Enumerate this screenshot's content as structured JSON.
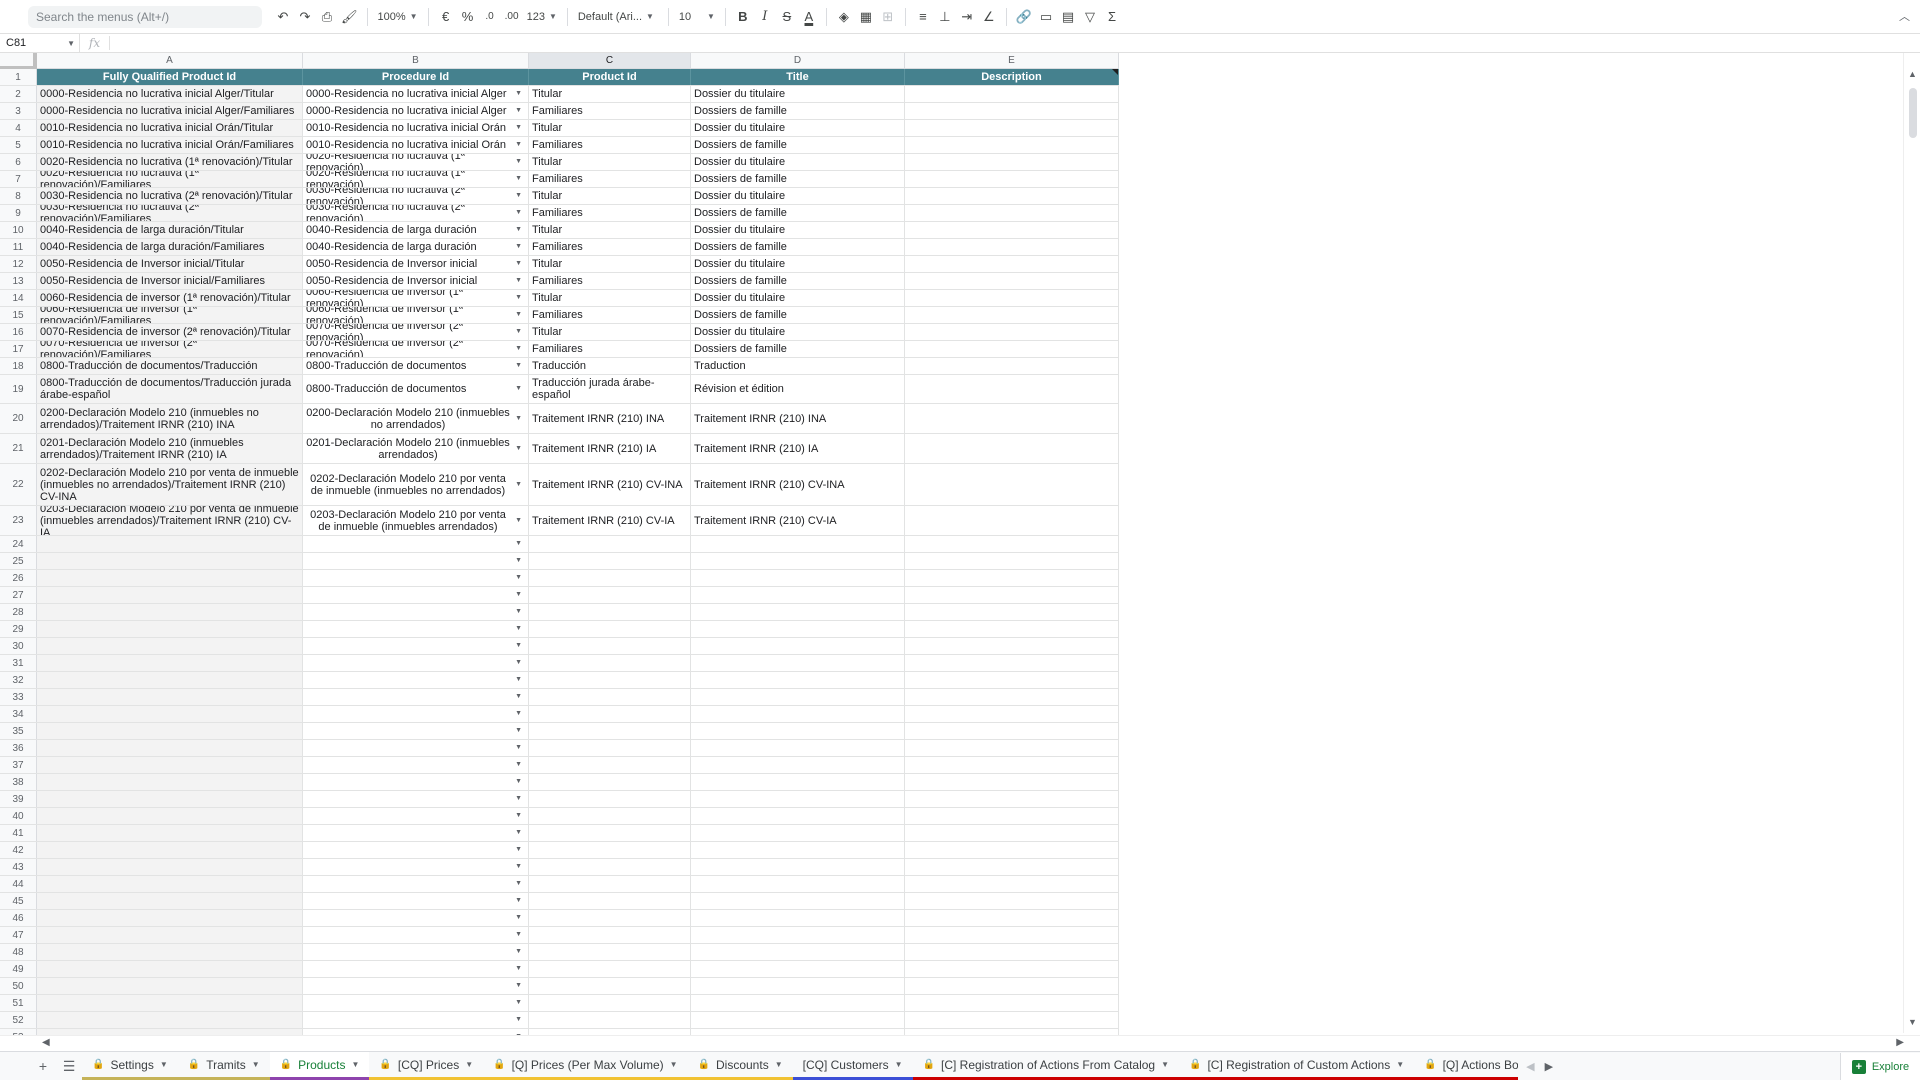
{
  "toolbar": {
    "search_placeholder": "Search the menus (Alt+/)",
    "zoom": "100%",
    "currency": "€",
    "percent": "%",
    "decrease_decimal": ".0",
    "increase_decimal": ".00",
    "number_format": "123",
    "font": "Default (Ari...",
    "font_size": "10",
    "bold": "B",
    "italic": "I",
    "strike": "S",
    "text_color": "A",
    "sum": "Σ"
  },
  "formula_bar": {
    "name_box": "C81",
    "fx": "fx"
  },
  "columns": [
    {
      "letter": "A",
      "width": 266,
      "selected": false
    },
    {
      "letter": "B",
      "width": 226,
      "selected": false
    },
    {
      "letter": "C",
      "width": 162,
      "selected": true
    },
    {
      "letter": "D",
      "width": 214,
      "selected": false
    },
    {
      "letter": "E",
      "width": 214,
      "selected": false
    }
  ],
  "header_row": [
    "Fully Qualified Product Id",
    "Procedure Id",
    "Product Id",
    "Title",
    "Description"
  ],
  "rows": [
    {
      "n": "2",
      "h": 17,
      "c": [
        "0000-Residencia no lucrativa inicial Alger/Titular",
        "0000-Residencia no lucrativa inicial Alger",
        "Titular",
        "Dossier du titulaire",
        ""
      ]
    },
    {
      "n": "3",
      "h": 17,
      "c": [
        "0000-Residencia no lucrativa inicial Alger/Familiares",
        "0000-Residencia no lucrativa inicial Alger",
        "Familiares",
        "Dossiers de famille",
        ""
      ]
    },
    {
      "n": "4",
      "h": 17,
      "c": [
        "0010-Residencia no lucrativa inicial Orán/Titular",
        "0010-Residencia no lucrativa inicial Orán",
        "Titular",
        "Dossier du titulaire",
        ""
      ]
    },
    {
      "n": "5",
      "h": 17,
      "c": [
        "0010-Residencia no lucrativa inicial Orán/Familiares",
        "0010-Residencia no lucrativa inicial Orán",
        "Familiares",
        "Dossiers de famille",
        ""
      ]
    },
    {
      "n": "6",
      "h": 17,
      "c": [
        "0020-Residencia no lucrativa (1ª renovación)/Titular",
        "0020-Residencia no lucrativa (1ª renovación)",
        "Titular",
        "Dossier du titulaire",
        ""
      ]
    },
    {
      "n": "7",
      "h": 17,
      "c": [
        "0020-Residencia no lucrativa (1ª renovación)/Familiares",
        "0020-Residencia no lucrativa (1ª renovación)",
        "Familiares",
        "Dossiers de famille",
        ""
      ]
    },
    {
      "n": "8",
      "h": 17,
      "c": [
        "0030-Residencia no lucrativa (2ª renovación)/Titular",
        "0030-Residencia no lucrativa (2ª renovación)",
        "Titular",
        "Dossier du titulaire",
        ""
      ]
    },
    {
      "n": "9",
      "h": 17,
      "c": [
        "0030-Residencia no lucrativa (2ª renovación)/Familiares",
        "0030-Residencia no lucrativa (2ª renovación)",
        "Familiares",
        "Dossiers de famille",
        ""
      ]
    },
    {
      "n": "10",
      "h": 17,
      "c": [
        "0040-Residencia de larga duración/Titular",
        "0040-Residencia de larga duración",
        "Titular",
        "Dossier du titulaire",
        ""
      ]
    },
    {
      "n": "11",
      "h": 17,
      "c": [
        "0040-Residencia de larga duración/Familiares",
        "0040-Residencia de larga duración",
        "Familiares",
        "Dossiers de famille",
        ""
      ]
    },
    {
      "n": "12",
      "h": 17,
      "c": [
        "0050-Residencia de Inversor inicial/Titular",
        "0050-Residencia de Inversor inicial",
        "Titular",
        "Dossier du titulaire",
        ""
      ]
    },
    {
      "n": "13",
      "h": 17,
      "c": [
        "0050-Residencia de Inversor inicial/Familiares",
        "0050-Residencia de Inversor inicial",
        "Familiares",
        "Dossiers de famille",
        ""
      ]
    },
    {
      "n": "14",
      "h": 17,
      "c": [
        "0060-Residencia de inversor (1ª renovación)/Titular",
        "0060-Residencia de inversor (1ª renovación)",
        "Titular",
        "Dossier du titulaire",
        ""
      ]
    },
    {
      "n": "15",
      "h": 17,
      "c": [
        "0060-Residencia de inversor (1ª renovación)/Familiares",
        "0060-Residencia de inversor (1ª renovación)",
        "Familiares",
        "Dossiers de famille",
        ""
      ]
    },
    {
      "n": "16",
      "h": 17,
      "c": [
        "0070-Residencia de inversor (2ª renovación)/Titular",
        "0070-Residencia de inversor (2ª renovación)",
        "Titular",
        "Dossier du titulaire",
        ""
      ]
    },
    {
      "n": "17",
      "h": 17,
      "c": [
        "0070-Residencia de inversor (2ª renovación)/Familiares",
        "0070-Residencia de inversor (2ª renovación)",
        "Familiares",
        "Dossiers de famille",
        ""
      ]
    },
    {
      "n": "18",
      "h": 17,
      "c": [
        "0800-Traducción de documentos/Traducción",
        "0800-Traducción de documentos",
        "Traducción",
        "Traduction",
        ""
      ]
    },
    {
      "n": "19",
      "h": 29,
      "c": [
        "0800-Traducción de documentos/Traducción jurada árabe-español",
        "0800-Traducción de documentos",
        "Traducción jurada árabe-español",
        "Révision et édition",
        ""
      ]
    },
    {
      "n": "20",
      "h": 30,
      "bc": true,
      "c": [
        "0200-Declaración Modelo 210 (inmuebles no arrendados)/Traitement IRNR (210) INA",
        "0200-Declaración Modelo 210 (inmuebles no arrendados)",
        "Traitement IRNR (210) INA",
        "Traitement IRNR (210) INA",
        ""
      ]
    },
    {
      "n": "21",
      "h": 30,
      "bc": true,
      "c": [
        "0201-Declaración Modelo 210 (inmuebles arrendados)/Traitement IRNR (210) IA",
        "0201-Declaración Modelo 210 (inmuebles arrendados)",
        "Traitement IRNR (210) IA",
        "Traitement IRNR (210) IA",
        ""
      ]
    },
    {
      "n": "22",
      "h": 42,
      "bc": true,
      "c": [
        "0202-Declaración Modelo 210 por venta de inmueble (inmuebles no arrendados)/Traitement IRNR (210) CV-INA",
        "0202-Declaración Modelo 210 por venta de inmueble (inmuebles no arrendados)",
        "Traitement IRNR (210) CV-INA",
        "Traitement IRNR (210) CV-INA",
        ""
      ]
    },
    {
      "n": "23",
      "h": 30,
      "bc": true,
      "c": [
        "0203-Declaración Modelo 210 por venta de inmueble (inmuebles arrendados)/Traitement IRNR (210) CV-IA",
        "0203-Declaración Modelo 210 por venta de inmueble (inmuebles arrendados)",
        "Traitement IRNR (210) CV-IA",
        "Traitement IRNR (210) CV-IA",
        ""
      ]
    }
  ],
  "empty_rows": [
    "24",
    "25",
    "26",
    "27",
    "28",
    "29",
    "30",
    "31",
    "32",
    "33",
    "34",
    "35",
    "36",
    "37",
    "38",
    "39",
    "40",
    "41",
    "42",
    "43",
    "44",
    "45",
    "46",
    "47",
    "48",
    "49",
    "50",
    "51",
    "52",
    "53"
  ],
  "tabs": [
    {
      "label": "Settings",
      "locked": true,
      "active": false,
      "color": "#c5b358"
    },
    {
      "label": "Tramits",
      "locked": true,
      "active": false,
      "color": "#c5b358"
    },
    {
      "label": "Products",
      "locked": true,
      "active": true,
      "color": "#8e44ad"
    },
    {
      "label": "[CQ] Prices",
      "locked": true,
      "active": false,
      "color": "#f1c232"
    },
    {
      "label": "[Q] Prices (Per Max Volume)",
      "locked": true,
      "active": false,
      "color": "#f1c232"
    },
    {
      "label": "Discounts",
      "locked": true,
      "active": false,
      "color": "#f1c232"
    },
    {
      "label": "[CQ] Customers",
      "locked": false,
      "active": false,
      "color": "#3c4fd6"
    },
    {
      "label": "[C] Registration of Actions From Catalog",
      "locked": true,
      "active": false,
      "color": "#cc0000"
    },
    {
      "label": "[C] Registration of Custom Actions",
      "locked": true,
      "active": false,
      "color": "#cc0000"
    },
    {
      "label": "[Q] Actions Bo",
      "locked": true,
      "active": false,
      "color": "#cc0000"
    }
  ],
  "explore_label": "Explore"
}
